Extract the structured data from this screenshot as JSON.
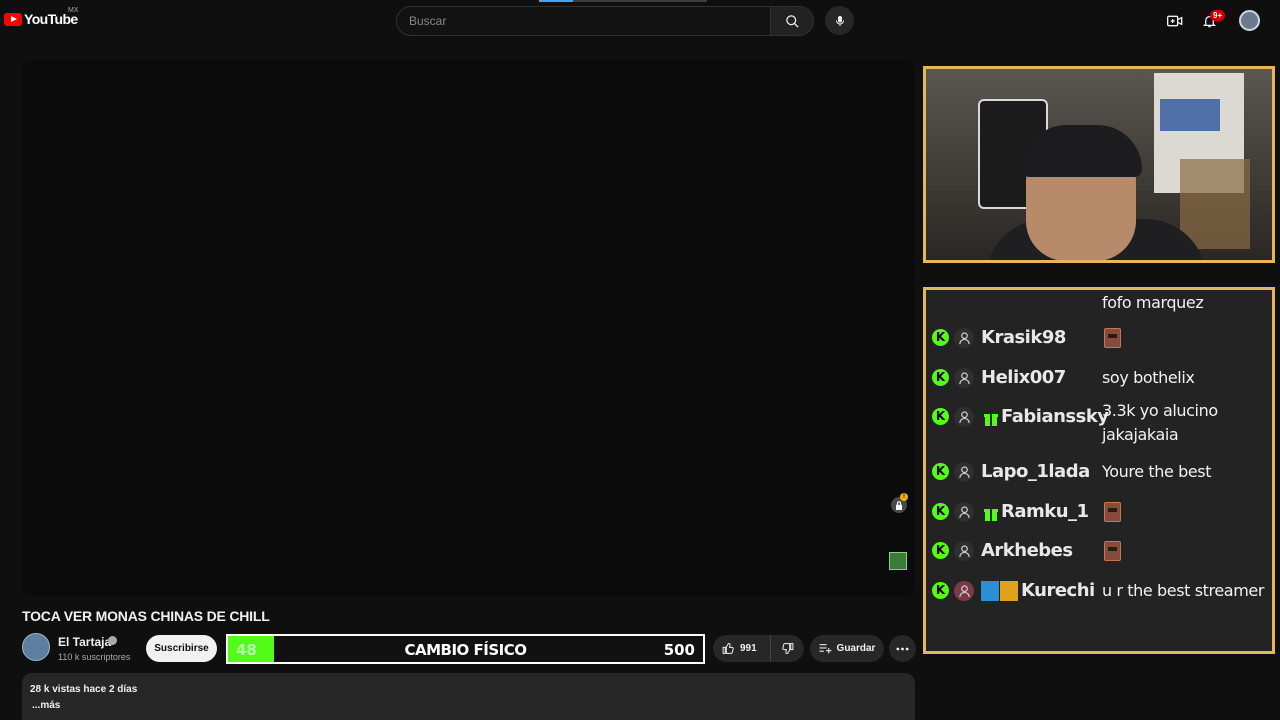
{
  "header": {
    "logo_text": "YouTube",
    "region": "MX",
    "search_placeholder": "Buscar",
    "notifications_badge": "9+",
    "video_progress": 0.2
  },
  "video": {
    "title": "TOCA VER MONAS CHINAS DE CHILL"
  },
  "channel": {
    "name": "El Tartaja",
    "subscribers": "110 k suscriptores",
    "subscribe_label": "Suscribirse"
  },
  "goal_bar": {
    "current": "48",
    "label": "CAMBIO FÍSICO",
    "target": "500",
    "progress": 0.096,
    "color": "#53fc18"
  },
  "actions": {
    "likes": "991",
    "save_label": "Guardar"
  },
  "description": {
    "meta": "28 k vistas  hace 2 días",
    "more": "...más"
  },
  "chat": {
    "border_color": "#e6b65a",
    "top_partial_message": "fofo marquez",
    "messages": [
      {
        "user": "Krasik98",
        "text": "",
        "emote": true,
        "gift": false
      },
      {
        "user": "Helix007",
        "text": "soy bothelix",
        "emote": false,
        "gift": false
      },
      {
        "user": "Fabianssky",
        "text": "3.3k yo alucino",
        "text2": "jakajakaia",
        "emote": false,
        "gift": true
      },
      {
        "user": "Lapo_1lada",
        "text": "Youre the best",
        "emote": false,
        "gift": false
      },
      {
        "user": "Ramku_1",
        "text": "",
        "emote": true,
        "gift": true
      },
      {
        "user": "Arkhebes",
        "text": "",
        "emote": true,
        "gift": false
      },
      {
        "user": "Kurechi",
        "text": "u r the best streamer",
        "emote": false,
        "gift": false
      }
    ]
  }
}
